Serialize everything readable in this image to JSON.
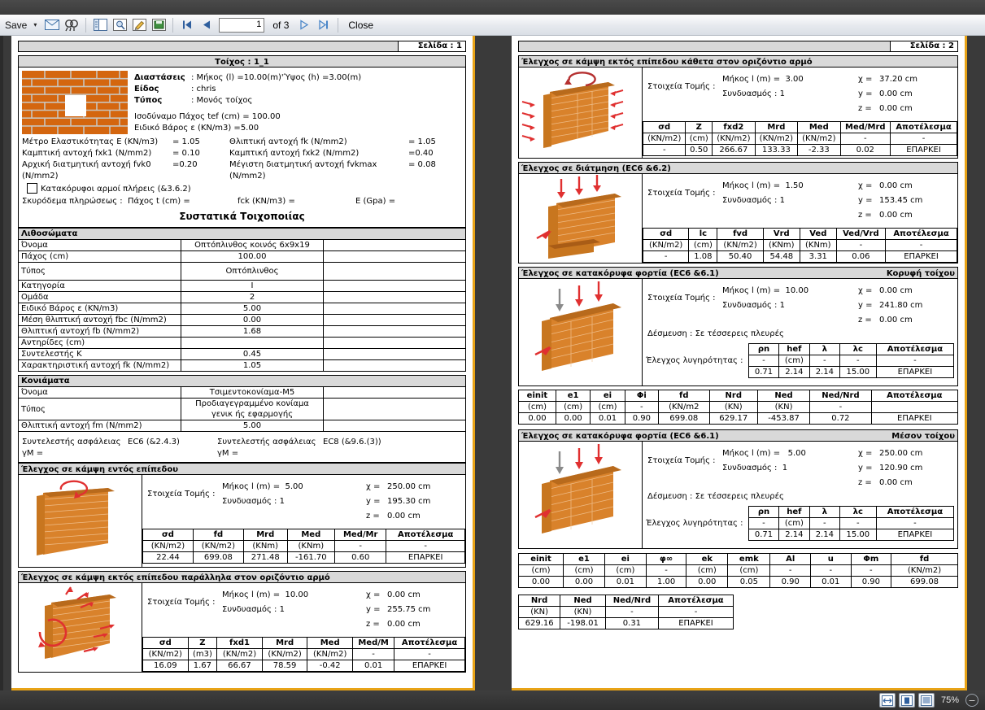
{
  "toolbar": {
    "save_label": "Save",
    "caret": "▾",
    "page_value": "1",
    "of_label": "of 3",
    "close_label": "Close",
    "icons": [
      "mail-icon",
      "find-icon",
      "panel-icon",
      "print-preview-icon",
      "edit-icon",
      "export-icon",
      "first-page-icon",
      "prev-page-icon",
      "next-page-icon",
      "last-page-icon"
    ]
  },
  "statusbar": {
    "zoom_level": "75%",
    "buttons": [
      "fit-width-icon",
      "single-page-icon",
      "continuous-page-icon",
      "zoom-out-icon"
    ]
  },
  "page1": {
    "page_label": "Σελίδα : 1",
    "wall_title": "Τοίχος : 1_1",
    "props": {
      "dimensions_label": "Διαστάσεις",
      "dimensions_value": ": Μήκος (l) =10.00(m)'Ύψος (h) =3.00(m)",
      "kind_label": "Είδος",
      "kind_value": ":  chris",
      "type_label": "Τύπος",
      "type_value": ":  Μονός τοίχος",
      "tef": "Ισοδύναμο Πάχος tef (cm) = 100.00",
      "weight": "Ειδικό Βάρος  ε (KN/m3)    =5.00",
      "rows": [
        {
          "l": "Μέτρο Ελαστικότητας Ε (KN/m3)",
          "v": "= 1.05",
          "r": "Θλιπτική αντοχή fk (N/mm2)",
          "rv": "= 1.05"
        },
        {
          "l": "Καμπτική αντοχή fxk1 (N/mm2)",
          "v": "= 0.10",
          "r": "Καμπτική αντοχή fxk2 (N/mm2)",
          "rv": "=0.40"
        },
        {
          "l": "Αρχική διατμητική αντοχή fvk0 (N/mm2)",
          "v": "=0.20",
          "r": "Μέγιστη  διατμητική αντοχή fvkmax (N/mm2)",
          "rv": "= 0.08"
        }
      ],
      "checkbox_label": "Κατακόρυφοι αρμοί πλήρεις (&3.6.2)",
      "checkbox_checked": false,
      "infill": "Σκυρόδεμα πληρώσεως :",
      "infill_t": "Πάχος t (cm) =",
      "infill_fck": "fck (KN/m3) =",
      "infill_e": "E (Gpa) ="
    },
    "components_title": "Συστατικά Τοιχοποιίας",
    "units": {
      "header": "Λιθοσώματα",
      "rows": [
        {
          "k": "Όνομα",
          "v": "Οπτόπλινθος κοινός 6x9x19"
        },
        {
          "k": "Πάχος (cm)",
          "v": "100.00"
        },
        {
          "k": "Τύπος",
          "v": "Οπτόπλινθος"
        },
        {
          "k": "Κατηγορία",
          "v": "Ι"
        },
        {
          "k": "Ομάδα",
          "v": "2"
        },
        {
          "k": "Ειδικό Βάρος  ε (KN/m3)",
          "v": "5.00"
        },
        {
          "k": "Μέση θλιπτική αντοχή fbc (N/mm2)",
          "v": "0.00"
        },
        {
          "k": "Θλιπτική αντοχή fb (N/mm2)",
          "v": "1.68"
        },
        {
          "k": "Αντηρίδες (cm)",
          "v": ""
        },
        {
          "k": "Συντελεστής Κ",
          "v": "0.45"
        },
        {
          "k": "Χαρακτηριστική αντοχή fk (N/mm2)",
          "v": "1.05"
        }
      ]
    },
    "mortar": {
      "header": "Κονιάματα",
      "rows": [
        {
          "k": "Όνομα",
          "v": "Τσιμεντοκονίαμα-Μ5"
        },
        {
          "k": "Τύπος",
          "v": "Προδιαγεγραμμένο κονίαμα\nγενικ ής εφαρμογής"
        },
        {
          "k": "Θλιπτική αντοχή fm (N/mm2)",
          "v": "5.00"
        }
      ],
      "safety_left": "Συντελεστής ασφάλειας  γΜ =",
      "safety_left_v": "EC6 (&2.4.3)",
      "safety_right": "Συντελεστής ασφάλειας  γΜ =",
      "safety_right_v": "EC8 (&9.6.(3))"
    },
    "check_in_plane": {
      "title": "Έλεγχος σε κάμψη εντός επίπεδου",
      "image": "wall-bending-in-plane-icon",
      "section_label": "Στοιχεία Τομής  :",
      "length_label": "Μήκος l (m) =",
      "length_value": "5.00",
      "combo_label": "Συνδυασμός :",
      "combo_value": "1",
      "x": "250.00 cm",
      "y": "195.30 cm",
      "z": "0.00 cm",
      "headers": [
        "σd",
        "fd",
        "Mrd",
        "Med",
        "Med/Mr",
        "Αποτέλεσμα"
      ],
      "units": [
        "(KN/m2)",
        "(KN/m2)",
        "(KNm)",
        "(KNm)",
        "-",
        "-"
      ],
      "values": [
        "22.44",
        "699.08",
        "271.48",
        "-161.70",
        "0.60",
        "ΕΠΑΡΚΕΙ"
      ]
    },
    "check_out_parallel": {
      "title": "Έλεγχος σε κάμψη εκτός επίπεδου παράλληλα στον οριζόντιο αρμό",
      "image": "wall-bending-parallel-icon",
      "section_label": "Στοιχεία Τομής  :",
      "length_label": "Μήκος l (m) =",
      "length_value": "10.00",
      "combo_label": "Συνδυασμός :",
      "combo_value": "1",
      "x": "0.00 cm",
      "y": "255.75 cm",
      "z": "0.00 cm",
      "headers": [
        "σd",
        "Z",
        "fxd1",
        "Mrd",
        "Med",
        "Med/M",
        "Αποτέλεσμα"
      ],
      "units": [
        "(KN/m2)",
        "(m3)",
        "(KN/m2)",
        "(KN/m2)",
        "(KN/m2)",
        "-",
        "-"
      ],
      "values": [
        "16.09",
        "1.67",
        "66.67",
        "78.59",
        "-0.42",
        "0.01",
        "ΕΠΑΡΚΕΙ"
      ]
    }
  },
  "page2": {
    "page_label": "Σελίδα : 2",
    "check_out_perp": {
      "title": "Έλεγχος σε κάμψη εκτός επίπεδου κάθετα στον οριζόντιο αρμό",
      "image": "wall-bending-perpendicular-icon",
      "section_label": "Στοιχεία Τομής  :",
      "length_label": "Μήκος l (m) =",
      "length_value": "3.00",
      "combo_label": "Συνδυασμός :",
      "combo_value": "1",
      "x": "37.20 cm",
      "y": "0.00 cm",
      "z": "0.00 cm",
      "headers": [
        "σd",
        "Z",
        "fxd2",
        "Mrd",
        "Med",
        "Med/Mrd",
        "Αποτέλεσμα"
      ],
      "units": [
        "(KN/m2)",
        "(cm)",
        "(KN/m2)",
        "(KN/m2)",
        "(KN/m2)",
        "-",
        "-"
      ],
      "values": [
        "-",
        "0.50",
        "266.67",
        "133.33",
        "-2.33",
        "0.02",
        "ΕΠΑΡΚΕΙ"
      ]
    },
    "check_shear": {
      "title": "Έλεγχος σε διάτμηση (EC6 &6.2)",
      "image": "wall-shear-icon",
      "section_label": "Στοιχεία Τομής  :",
      "length_label": "Μήκος l (m) =",
      "length_value": "1.50",
      "combo_label": "Συνδυασμός :",
      "combo_value": "1",
      "x": "0.00 cm",
      "y": "153.45 cm",
      "z": "0.00 cm",
      "headers": [
        "σd",
        "lc",
        "fvd",
        "Vrd",
        "Ved",
        "Ved/Vrd",
        "Αποτέλεσμα"
      ],
      "units": [
        "(KN/m2)",
        "(cm)",
        "(KN/m2)",
        "(KNm)",
        "(KNm)",
        "-",
        "-"
      ],
      "values": [
        "-",
        "1.08",
        "50.40",
        "54.48",
        "3.31",
        "0.06",
        "ΕΠΑΡΚΕΙ"
      ]
    },
    "check_vertical_top": {
      "title": "Έλεγχος σε κατακόρυφα φορτία (EC6 &6.1)",
      "subtitle": "Κορυφή τοίχου",
      "image": "wall-vertical-load-icon",
      "section_label": "Στοιχεία Τομής  :",
      "length_label": "Μήκος l (m) =",
      "length_value": "10.00",
      "combo_label": "Συνδυασμός :",
      "combo_value": "1",
      "restraint_label": "Δέσμευση  :",
      "restraint_value": "Σε τέσσερεις πλευρές",
      "slenderness_label": "Έλεγχος λυγηρότητας :",
      "x": "0.00 cm",
      "y": "241.80 cm",
      "z": "0.00 cm",
      "slen_headers": [
        "ρn",
        "hef",
        "λ",
        "λc",
        "Αποτέλεσμα"
      ],
      "slen_units": [
        "-",
        "(cm)",
        "-",
        "-",
        "-"
      ],
      "slen_values": [
        "0.71",
        "2.14",
        "2.14",
        "15.00",
        "ΕΠΑΡΚΕΙ"
      ],
      "headers": [
        "einit",
        "e1",
        "ei",
        "Φi",
        "fd",
        "Nrd",
        "Ned",
        "Ned/Nrd",
        "Αποτέλεσμα"
      ],
      "units": [
        "(cm)",
        "(cm)",
        "(cm)",
        "-",
        "(KN/m2",
        "(KN)",
        "(KN)",
        "-",
        ""
      ],
      "values": [
        "0.00",
        "0.00",
        "0.01",
        "0.90",
        "699.08",
        "629.17",
        "-453.87",
        "0.72",
        "ΕΠΑΡΚΕΙ"
      ]
    },
    "check_vertical_mid": {
      "title": "Έλεγχος σε κατακόρυφα φορτία (EC6 &6.1)",
      "subtitle": "Μέσον τοίχου",
      "image": "wall-vertical-load-icon",
      "section_label": "Στοιχεία Τομής  :",
      "length_label": "Μήκος l (m) =",
      "length_value": "5.00",
      "combo_label": "Συνδυασμός :",
      "combo_value": "1",
      "restraint_label": "Δέσμευση  :",
      "restraint_value": "Σε τέσσερεις πλευρές",
      "slenderness_label": "Έλεγχος λυγηρότητας :",
      "x": "250.00 cm",
      "y": "120.90 cm",
      "z": "0.00 cm",
      "slen_headers": [
        "ρn",
        "hef",
        "λ",
        "λc",
        "Αποτέλεσμα"
      ],
      "slen_units": [
        "-",
        "(cm)",
        "-",
        "-",
        "-"
      ],
      "slen_values": [
        "0.71",
        "2.14",
        "2.14",
        "15.00",
        "ΕΠΑΡΚΕΙ"
      ],
      "headers": [
        "einit",
        "e1",
        "ei",
        "φ∞",
        "ek",
        "emk",
        "Al",
        "u",
        "Φm",
        "fd"
      ],
      "units": [
        "(cm)",
        "(cm)",
        "(cm)",
        "-",
        "(cm)",
        "(cm)",
        "-",
        "-",
        "-",
        "(KN/m2)"
      ],
      "values": [
        "0.00",
        "0.00",
        "0.01",
        "1.00",
        "0.00",
        "0.05",
        "0.90",
        "0.01",
        "0.90",
        "699.08"
      ],
      "headers2": [
        "Nrd",
        "Ned",
        "Ned/Nrd",
        "Αποτέλεσμα"
      ],
      "units2": [
        "(KN)",
        "(KN)",
        "-",
        "-"
      ],
      "values2": [
        "629.16",
        "-198.01",
        "0.31",
        "ΕΠΑΡΚΕΙ"
      ]
    }
  }
}
